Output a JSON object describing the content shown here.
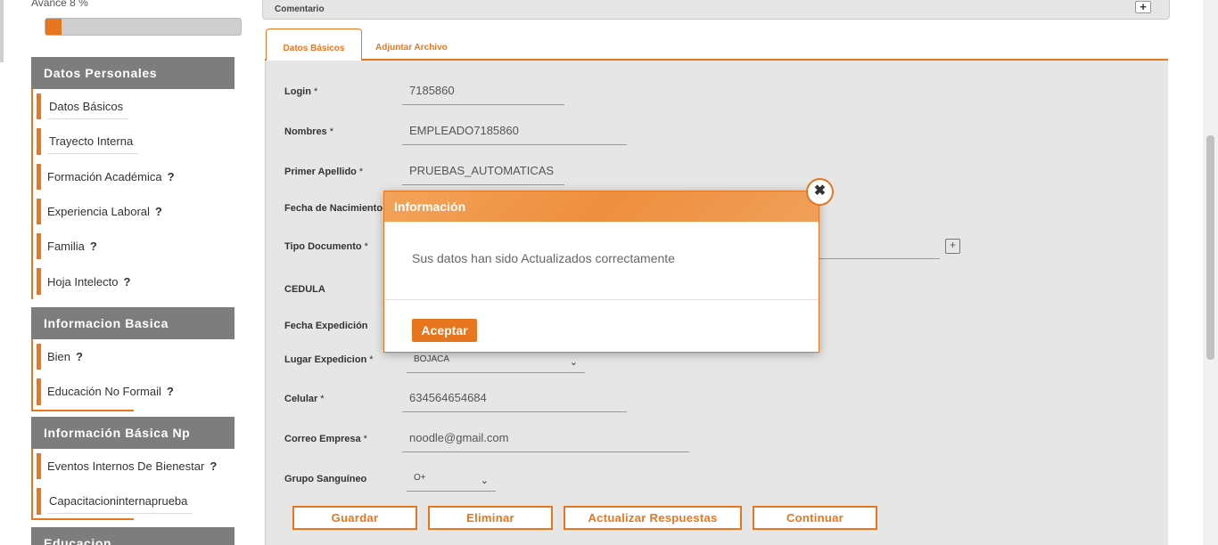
{
  "sidebar": {
    "progress_label": "Avance 8 %",
    "progress_percent": 8,
    "sections": [
      {
        "title": "Datos Personales",
        "items": [
          {
            "label": "Datos Básicos",
            "q": ""
          },
          {
            "label": "Trayecto Interna",
            "q": ""
          },
          {
            "label": "Formación Académica",
            "q": "?"
          },
          {
            "label": "Experiencia Laboral",
            "q": "?"
          },
          {
            "label": "Familia",
            "q": "?"
          },
          {
            "label": "Hoja Intelecto",
            "q": "?"
          }
        ]
      },
      {
        "title": "Informacion Basica",
        "items": [
          {
            "label": "Bien",
            "q": "?"
          },
          {
            "label": "Educación No Formail",
            "q": "?"
          }
        ]
      },
      {
        "title": "Información Básica Np",
        "items": [
          {
            "label": "Eventos Internos De Bienestar",
            "q": "?"
          },
          {
            "label": "Capacitacioninternaprueba",
            "q": ""
          }
        ]
      },
      {
        "title": "Educacion",
        "items": []
      }
    ]
  },
  "comment_bar": {
    "label": "Comentario",
    "plus": "+"
  },
  "tabs": [
    {
      "label": "Datos Básicos"
    },
    {
      "label": "Adjuntar Archivo"
    }
  ],
  "form": {
    "login": {
      "label": "Login",
      "value": "7185860"
    },
    "nombres": {
      "label": "Nombres",
      "value": "EMPLEADO7185860"
    },
    "primer_apellido": {
      "label": "Primer Apellido",
      "value": "PRUEBAS_AUTOMATICAS"
    },
    "fecha_nacimiento": {
      "label": "Fecha de Nacimiento"
    },
    "tipo_documento": {
      "label": "Tipo Documento"
    },
    "cedula": {
      "label": "CEDULA"
    },
    "fecha_expedicion": {
      "label": "Fecha Expedición"
    },
    "lugar_expedicion": {
      "label": "Lugar Expedicion",
      "value": "BOJACA"
    },
    "celular": {
      "label": "Celular",
      "value": "634564654684"
    },
    "correo_empresa": {
      "label": "Correo Empresa",
      "value": "noodle@gmail.com"
    },
    "grupo_sanguineo": {
      "label": "Grupo Sanguíneo",
      "value": "O+"
    },
    "required_mark": "*"
  },
  "buttons": {
    "guardar": "Guardar",
    "eliminar": "Eliminar",
    "actualizar": "Actualizar Respuestas",
    "continuar": "Continuar"
  },
  "modal": {
    "title": "Información",
    "message": "Sus datos han sido Actualizados correctamente",
    "accept": "Aceptar",
    "close_symbol": "✖"
  },
  "colors": {
    "accent": "#e8761e",
    "sidebar_header": "#7d7d7d",
    "panel": "#e6e6e6"
  }
}
